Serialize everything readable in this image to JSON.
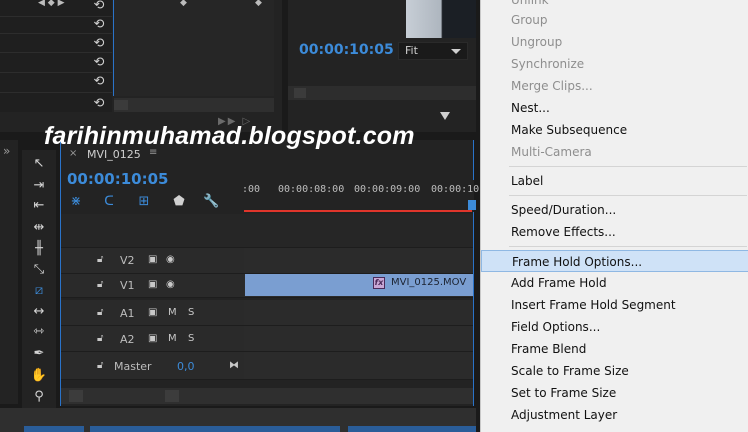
{
  "watermark": "farihinmuhamad.blogspot.com",
  "monitor": {
    "timecode": "00:00:10:05",
    "fit_label": "Fit"
  },
  "timeline": {
    "tab_name": "MVI_0125",
    "timecode": "00:00:10:05",
    "ruler_labels": [
      ":00",
      "00:00:08:00",
      "00:00:09:00",
      "00:00:10"
    ],
    "tracks": [
      {
        "name": "V2"
      },
      {
        "name": "V1"
      },
      {
        "name": "A1"
      },
      {
        "name": "A2"
      }
    ],
    "mute_label": "M",
    "solo_label": "S",
    "master": {
      "name": "Master",
      "value": "0,0"
    },
    "clip": {
      "fx": "fx",
      "name": "MVI_0125.MOV"
    }
  },
  "menu": {
    "items": [
      {
        "label": "Unlink",
        "disabled": true
      },
      {
        "label": "Group",
        "disabled": true
      },
      {
        "label": "Ungroup",
        "disabled": true
      },
      {
        "label": "Synchronize",
        "disabled": true
      },
      {
        "label": "Merge Clips...",
        "disabled": true
      },
      {
        "label": "Nest...",
        "disabled": false
      },
      {
        "label": "Make Subsequence",
        "disabled": false
      },
      {
        "label": "Multi-Camera",
        "disabled": true
      },
      {
        "label": "Label",
        "disabled": false
      },
      {
        "label": "Speed/Duration...",
        "disabled": false
      },
      {
        "label": "Remove Effects...",
        "disabled": false
      },
      {
        "label": "Frame Hold Options...",
        "disabled": false,
        "highlighted": true
      },
      {
        "label": "Add Frame Hold",
        "disabled": false
      },
      {
        "label": "Insert Frame Hold Segment",
        "disabled": false
      },
      {
        "label": "Field Options...",
        "disabled": false
      },
      {
        "label": "Frame Blend",
        "disabled": false
      },
      {
        "label": "Scale to Frame Size",
        "disabled": false
      },
      {
        "label": "Set to Frame Size",
        "disabled": false
      },
      {
        "label": "Adjustment Layer",
        "disabled": false
      }
    ]
  },
  "colors": {
    "accent_blue": "#3c8bd9",
    "playhead_red": "#e0352b",
    "clip_blue": "#7a9ed1",
    "menu_highlight": "#cfe2f7"
  }
}
